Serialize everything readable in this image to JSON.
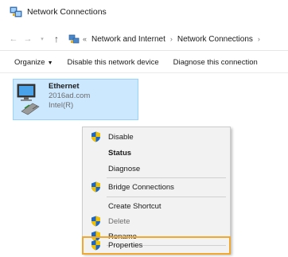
{
  "window": {
    "title": "Network Connections"
  },
  "address": {
    "back_icon": "left-arrow-icon",
    "forward_icon": "right-arrow-icon",
    "dropdown_icon": "chevron-down-icon",
    "up_icon": "up-arrow-icon",
    "overflow": "«",
    "crumbs": [
      "Network and Internet",
      "Network Connections"
    ]
  },
  "toolbar": {
    "organize": "Organize",
    "disable": "Disable this network device",
    "diagnose": "Diagnose this connection"
  },
  "connection": {
    "name": "Ethernet",
    "domain": "2016ad.com",
    "adapter": "Intel(R)"
  },
  "menu": {
    "disable": "Disable",
    "status": "Status",
    "diagnose": "Diagnose",
    "bridge": "Bridge Connections",
    "create_shortcut": "Create Shortcut",
    "delete": "Delete",
    "rename": "Rename",
    "properties": "Properties"
  },
  "colors": {
    "selection_bg": "#cce8ff",
    "selection_border": "#99d1ff",
    "highlight": "#f0a830",
    "menu_bg": "#f2f2f2"
  }
}
